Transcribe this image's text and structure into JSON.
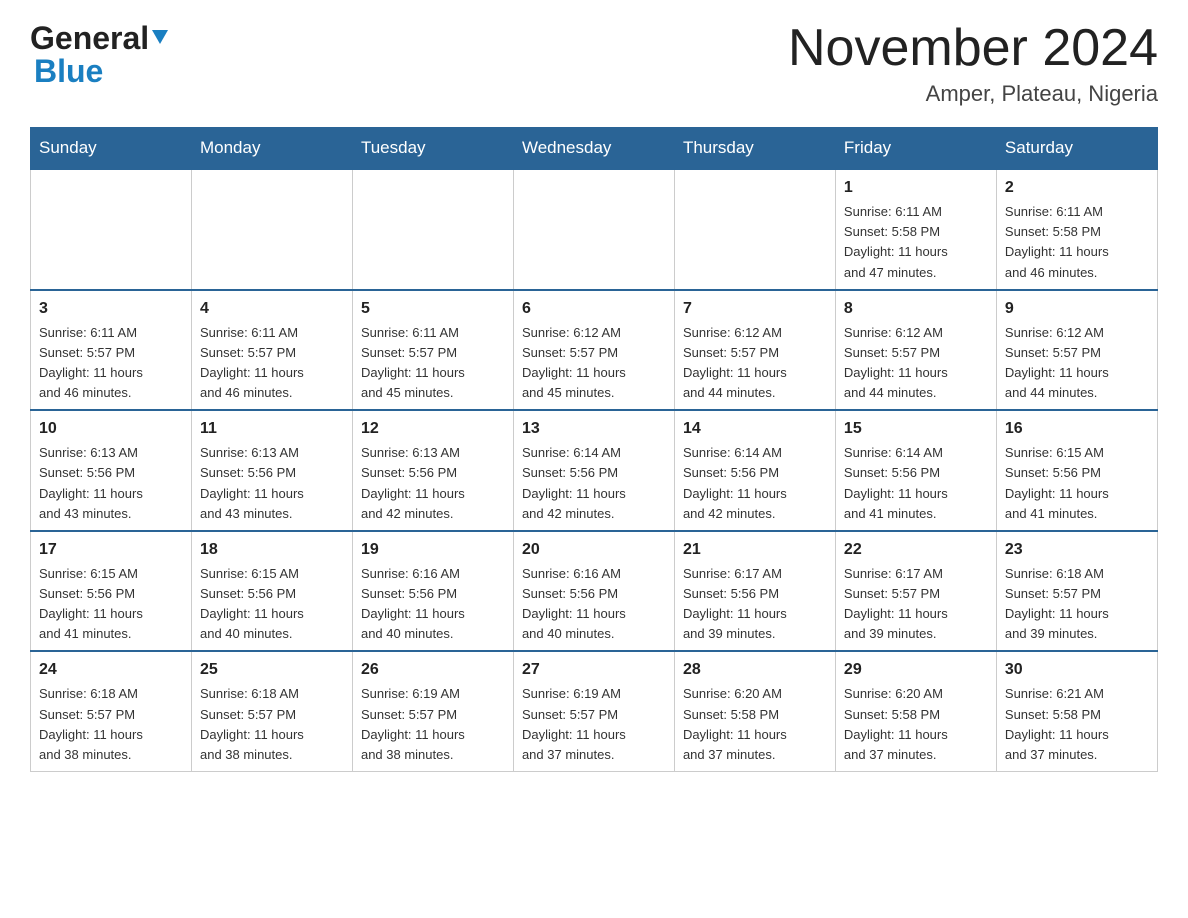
{
  "header": {
    "logo_general": "General",
    "logo_blue": "Blue",
    "month_year": "November 2024",
    "location": "Amper, Plateau, Nigeria"
  },
  "days_of_week": [
    "Sunday",
    "Monday",
    "Tuesday",
    "Wednesday",
    "Thursday",
    "Friday",
    "Saturday"
  ],
  "weeks": [
    [
      {
        "day": "",
        "info": ""
      },
      {
        "day": "",
        "info": ""
      },
      {
        "day": "",
        "info": ""
      },
      {
        "day": "",
        "info": ""
      },
      {
        "day": "",
        "info": ""
      },
      {
        "day": "1",
        "info": "Sunrise: 6:11 AM\nSunset: 5:58 PM\nDaylight: 11 hours\nand 47 minutes."
      },
      {
        "day": "2",
        "info": "Sunrise: 6:11 AM\nSunset: 5:58 PM\nDaylight: 11 hours\nand 46 minutes."
      }
    ],
    [
      {
        "day": "3",
        "info": "Sunrise: 6:11 AM\nSunset: 5:57 PM\nDaylight: 11 hours\nand 46 minutes."
      },
      {
        "day": "4",
        "info": "Sunrise: 6:11 AM\nSunset: 5:57 PM\nDaylight: 11 hours\nand 46 minutes."
      },
      {
        "day": "5",
        "info": "Sunrise: 6:11 AM\nSunset: 5:57 PM\nDaylight: 11 hours\nand 45 minutes."
      },
      {
        "day": "6",
        "info": "Sunrise: 6:12 AM\nSunset: 5:57 PM\nDaylight: 11 hours\nand 45 minutes."
      },
      {
        "day": "7",
        "info": "Sunrise: 6:12 AM\nSunset: 5:57 PM\nDaylight: 11 hours\nand 44 minutes."
      },
      {
        "day": "8",
        "info": "Sunrise: 6:12 AM\nSunset: 5:57 PM\nDaylight: 11 hours\nand 44 minutes."
      },
      {
        "day": "9",
        "info": "Sunrise: 6:12 AM\nSunset: 5:57 PM\nDaylight: 11 hours\nand 44 minutes."
      }
    ],
    [
      {
        "day": "10",
        "info": "Sunrise: 6:13 AM\nSunset: 5:56 PM\nDaylight: 11 hours\nand 43 minutes."
      },
      {
        "day": "11",
        "info": "Sunrise: 6:13 AM\nSunset: 5:56 PM\nDaylight: 11 hours\nand 43 minutes."
      },
      {
        "day": "12",
        "info": "Sunrise: 6:13 AM\nSunset: 5:56 PM\nDaylight: 11 hours\nand 42 minutes."
      },
      {
        "day": "13",
        "info": "Sunrise: 6:14 AM\nSunset: 5:56 PM\nDaylight: 11 hours\nand 42 minutes."
      },
      {
        "day": "14",
        "info": "Sunrise: 6:14 AM\nSunset: 5:56 PM\nDaylight: 11 hours\nand 42 minutes."
      },
      {
        "day": "15",
        "info": "Sunrise: 6:14 AM\nSunset: 5:56 PM\nDaylight: 11 hours\nand 41 minutes."
      },
      {
        "day": "16",
        "info": "Sunrise: 6:15 AM\nSunset: 5:56 PM\nDaylight: 11 hours\nand 41 minutes."
      }
    ],
    [
      {
        "day": "17",
        "info": "Sunrise: 6:15 AM\nSunset: 5:56 PM\nDaylight: 11 hours\nand 41 minutes."
      },
      {
        "day": "18",
        "info": "Sunrise: 6:15 AM\nSunset: 5:56 PM\nDaylight: 11 hours\nand 40 minutes."
      },
      {
        "day": "19",
        "info": "Sunrise: 6:16 AM\nSunset: 5:56 PM\nDaylight: 11 hours\nand 40 minutes."
      },
      {
        "day": "20",
        "info": "Sunrise: 6:16 AM\nSunset: 5:56 PM\nDaylight: 11 hours\nand 40 minutes."
      },
      {
        "day": "21",
        "info": "Sunrise: 6:17 AM\nSunset: 5:56 PM\nDaylight: 11 hours\nand 39 minutes."
      },
      {
        "day": "22",
        "info": "Sunrise: 6:17 AM\nSunset: 5:57 PM\nDaylight: 11 hours\nand 39 minutes."
      },
      {
        "day": "23",
        "info": "Sunrise: 6:18 AM\nSunset: 5:57 PM\nDaylight: 11 hours\nand 39 minutes."
      }
    ],
    [
      {
        "day": "24",
        "info": "Sunrise: 6:18 AM\nSunset: 5:57 PM\nDaylight: 11 hours\nand 38 minutes."
      },
      {
        "day": "25",
        "info": "Sunrise: 6:18 AM\nSunset: 5:57 PM\nDaylight: 11 hours\nand 38 minutes."
      },
      {
        "day": "26",
        "info": "Sunrise: 6:19 AM\nSunset: 5:57 PM\nDaylight: 11 hours\nand 38 minutes."
      },
      {
        "day": "27",
        "info": "Sunrise: 6:19 AM\nSunset: 5:57 PM\nDaylight: 11 hours\nand 37 minutes."
      },
      {
        "day": "28",
        "info": "Sunrise: 6:20 AM\nSunset: 5:58 PM\nDaylight: 11 hours\nand 37 minutes."
      },
      {
        "day": "29",
        "info": "Sunrise: 6:20 AM\nSunset: 5:58 PM\nDaylight: 11 hours\nand 37 minutes."
      },
      {
        "day": "30",
        "info": "Sunrise: 6:21 AM\nSunset: 5:58 PM\nDaylight: 11 hours\nand 37 minutes."
      }
    ]
  ]
}
